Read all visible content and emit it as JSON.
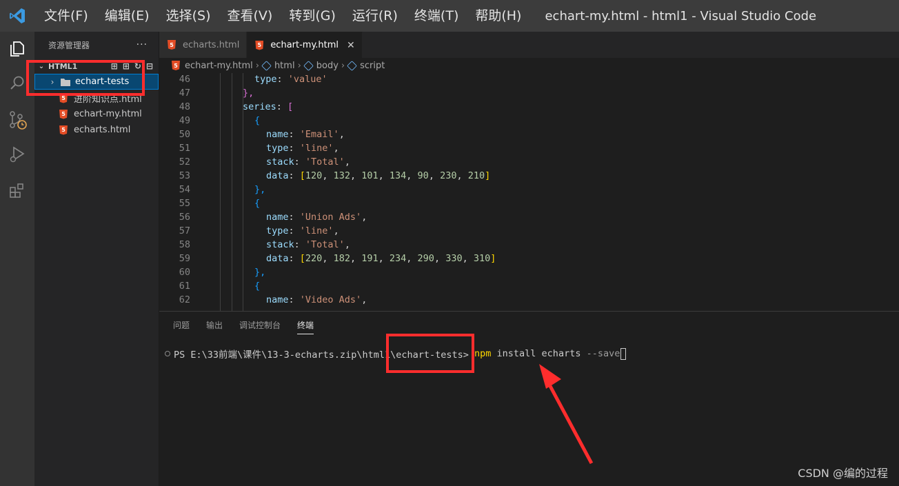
{
  "titlebar": {
    "menu": [
      "文件(F)",
      "编辑(E)",
      "选择(S)",
      "查看(V)",
      "转到(G)",
      "运行(R)",
      "终端(T)",
      "帮助(H)"
    ],
    "window_title": "echart-my.html - html1 - Visual Studio Code"
  },
  "activity_bar": {
    "icons": [
      "explorer-icon",
      "search-icon",
      "source-control-icon",
      "run-debug-icon",
      "extensions-icon"
    ]
  },
  "sidebar": {
    "header": "资源管理器",
    "more": "···",
    "section_title": "HTML1",
    "tree": {
      "folder": "echart-tests",
      "files": [
        "进阶知识点.html",
        "echart-my.html",
        "echarts.html"
      ]
    }
  },
  "tabs": [
    {
      "label": "echarts.html",
      "active": false
    },
    {
      "label": "echart-my.html",
      "active": true,
      "close": "✕"
    }
  ],
  "breadcrumb": [
    "echart-my.html",
    "html",
    "body",
    "script"
  ],
  "code_lines": [
    {
      "num": "46",
      "indent": 1,
      "tokens": [
        [
          "type",
          "prop"
        ],
        [
          ": ",
          "punct"
        ],
        [
          "'value'",
          "str"
        ]
      ]
    },
    {
      "num": "47",
      "indent": 0,
      "tokens": [
        [
          "},",
          "brace1"
        ]
      ]
    },
    {
      "num": "48",
      "indent": 0,
      "tokens": [
        [
          "series",
          "prop"
        ],
        [
          ": ",
          "punct"
        ],
        [
          "[",
          "brace1"
        ]
      ]
    },
    {
      "num": "49",
      "indent": 1,
      "tokens": [
        [
          "{",
          "brace2"
        ]
      ]
    },
    {
      "num": "50",
      "indent": 2,
      "tokens": [
        [
          "name",
          "prop"
        ],
        [
          ": ",
          "punct"
        ],
        [
          "'Email'",
          "str"
        ],
        [
          ",",
          "punct"
        ]
      ]
    },
    {
      "num": "51",
      "indent": 2,
      "tokens": [
        [
          "type",
          "prop"
        ],
        [
          ": ",
          "punct"
        ],
        [
          "'line'",
          "str"
        ],
        [
          ",",
          "punct"
        ]
      ]
    },
    {
      "num": "52",
      "indent": 2,
      "tokens": [
        [
          "stack",
          "prop"
        ],
        [
          ": ",
          "punct"
        ],
        [
          "'Total'",
          "str"
        ],
        [
          ",",
          "punct"
        ]
      ]
    },
    {
      "num": "53",
      "indent": 2,
      "tokens": [
        [
          "data",
          "prop"
        ],
        [
          ": ",
          "punct"
        ],
        [
          "[",
          "brace3"
        ],
        [
          "120",
          "num"
        ],
        [
          ", ",
          "punct"
        ],
        [
          "132",
          "num"
        ],
        [
          ", ",
          "punct"
        ],
        [
          "101",
          "num"
        ],
        [
          ", ",
          "punct"
        ],
        [
          "134",
          "num"
        ],
        [
          ", ",
          "punct"
        ],
        [
          "90",
          "num"
        ],
        [
          ", ",
          "punct"
        ],
        [
          "230",
          "num"
        ],
        [
          ", ",
          "punct"
        ],
        [
          "210",
          "num"
        ],
        [
          "]",
          "brace3"
        ]
      ]
    },
    {
      "num": "54",
      "indent": 1,
      "tokens": [
        [
          "},",
          "brace2"
        ]
      ]
    },
    {
      "num": "55",
      "indent": 1,
      "tokens": [
        [
          "{",
          "brace2"
        ]
      ]
    },
    {
      "num": "56",
      "indent": 2,
      "tokens": [
        [
          "name",
          "prop"
        ],
        [
          ": ",
          "punct"
        ],
        [
          "'Union Ads'",
          "str"
        ],
        [
          ",",
          "punct"
        ]
      ]
    },
    {
      "num": "57",
      "indent": 2,
      "tokens": [
        [
          "type",
          "prop"
        ],
        [
          ": ",
          "punct"
        ],
        [
          "'line'",
          "str"
        ],
        [
          ",",
          "punct"
        ]
      ]
    },
    {
      "num": "58",
      "indent": 2,
      "tokens": [
        [
          "stack",
          "prop"
        ],
        [
          ": ",
          "punct"
        ],
        [
          "'Total'",
          "str"
        ],
        [
          ",",
          "punct"
        ]
      ]
    },
    {
      "num": "59",
      "indent": 2,
      "tokens": [
        [
          "data",
          "prop"
        ],
        [
          ": ",
          "punct"
        ],
        [
          "[",
          "brace3"
        ],
        [
          "220",
          "num"
        ],
        [
          ", ",
          "punct"
        ],
        [
          "182",
          "num"
        ],
        [
          ", ",
          "punct"
        ],
        [
          "191",
          "num"
        ],
        [
          ", ",
          "punct"
        ],
        [
          "234",
          "num"
        ],
        [
          ", ",
          "punct"
        ],
        [
          "290",
          "num"
        ],
        [
          ", ",
          "punct"
        ],
        [
          "330",
          "num"
        ],
        [
          ", ",
          "punct"
        ],
        [
          "310",
          "num"
        ],
        [
          "]",
          "brace3"
        ]
      ]
    },
    {
      "num": "60",
      "indent": 1,
      "tokens": [
        [
          "},",
          "brace2"
        ]
      ]
    },
    {
      "num": "61",
      "indent": 1,
      "tokens": [
        [
          "{",
          "brace2"
        ]
      ]
    },
    {
      "num": "62",
      "indent": 2,
      "tokens": [
        [
          "name",
          "prop"
        ],
        [
          ": ",
          "punct"
        ],
        [
          "'Video Ads'",
          "str"
        ],
        [
          ",",
          "punct"
        ]
      ]
    }
  ],
  "panel": {
    "tabs": [
      "问题",
      "输出",
      "调试控制台",
      "终端"
    ],
    "active_tab": "终端"
  },
  "terminal": {
    "prompt": "PS E:\\33前端\\课件\\13-3-echarts.zip\\html1\\echart-tests> ",
    "cmd_npm": "npm",
    "cmd_rest": " install echarts ",
    "cmd_flag": "--save"
  },
  "watermark": "CSDN @编的过程",
  "colors": {
    "prop": "#9cdcfe",
    "str": "#ce9178",
    "num": "#b5cea8",
    "punct": "#d4d4d4",
    "brace1": "#da70d6",
    "brace2": "#179fff",
    "brace3": "#ffd700",
    "accent": "#007acc",
    "annotation": "#ff2d2d"
  }
}
